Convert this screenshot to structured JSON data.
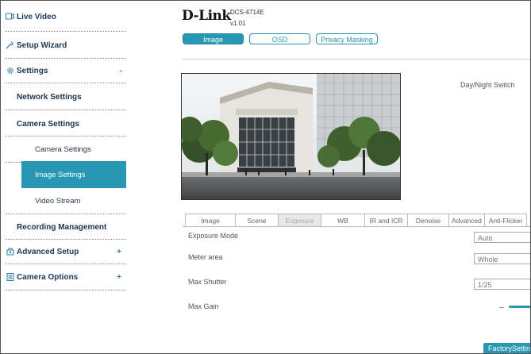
{
  "sidebar": {
    "live_video": "Live Video",
    "setup_wizard": "Setup Wizard",
    "settings": "Settings",
    "settings_sign": "-",
    "network_settings": "Network Settings",
    "camera_settings": "Camera Settings",
    "camera_settings_leaf": "Camera Settings",
    "image_settings": "Image Settings",
    "video_stream": "Video Stream",
    "recording_management": "Recording Management",
    "advanced_setup": "Advanced Setup",
    "advanced_sign": "+",
    "camera_options": "Camera Options",
    "camera_options_sign": "+"
  },
  "header": {
    "brand": "D-Link",
    "model": "DCS-4714E",
    "firmware": "v1.01"
  },
  "tabs": {
    "image": "Image",
    "osd": "OSD",
    "privacy": "Privacy Masking"
  },
  "day_night_label": "Day/Night Switch",
  "subtabs": [
    "Image",
    "Scene",
    "Exposure",
    "WB",
    "IR and ICR",
    "Denoise",
    "Advanced",
    "Anti-Flicker"
  ],
  "settings": {
    "exposure_mode_label": "Exposure Mode",
    "exposure_mode_value": "Auto",
    "meter_area_label": "Meter area",
    "meter_area_value": "Whole",
    "max_shutter_label": "Max Shutter",
    "max_shutter_value": "1/25",
    "max_gain_label": "Max Gain",
    "slider_minus": "−"
  },
  "factory_button": "FactorySetting",
  "colors": {
    "accent": "#2797b3",
    "sidebar_text": "#1a3a5c"
  }
}
